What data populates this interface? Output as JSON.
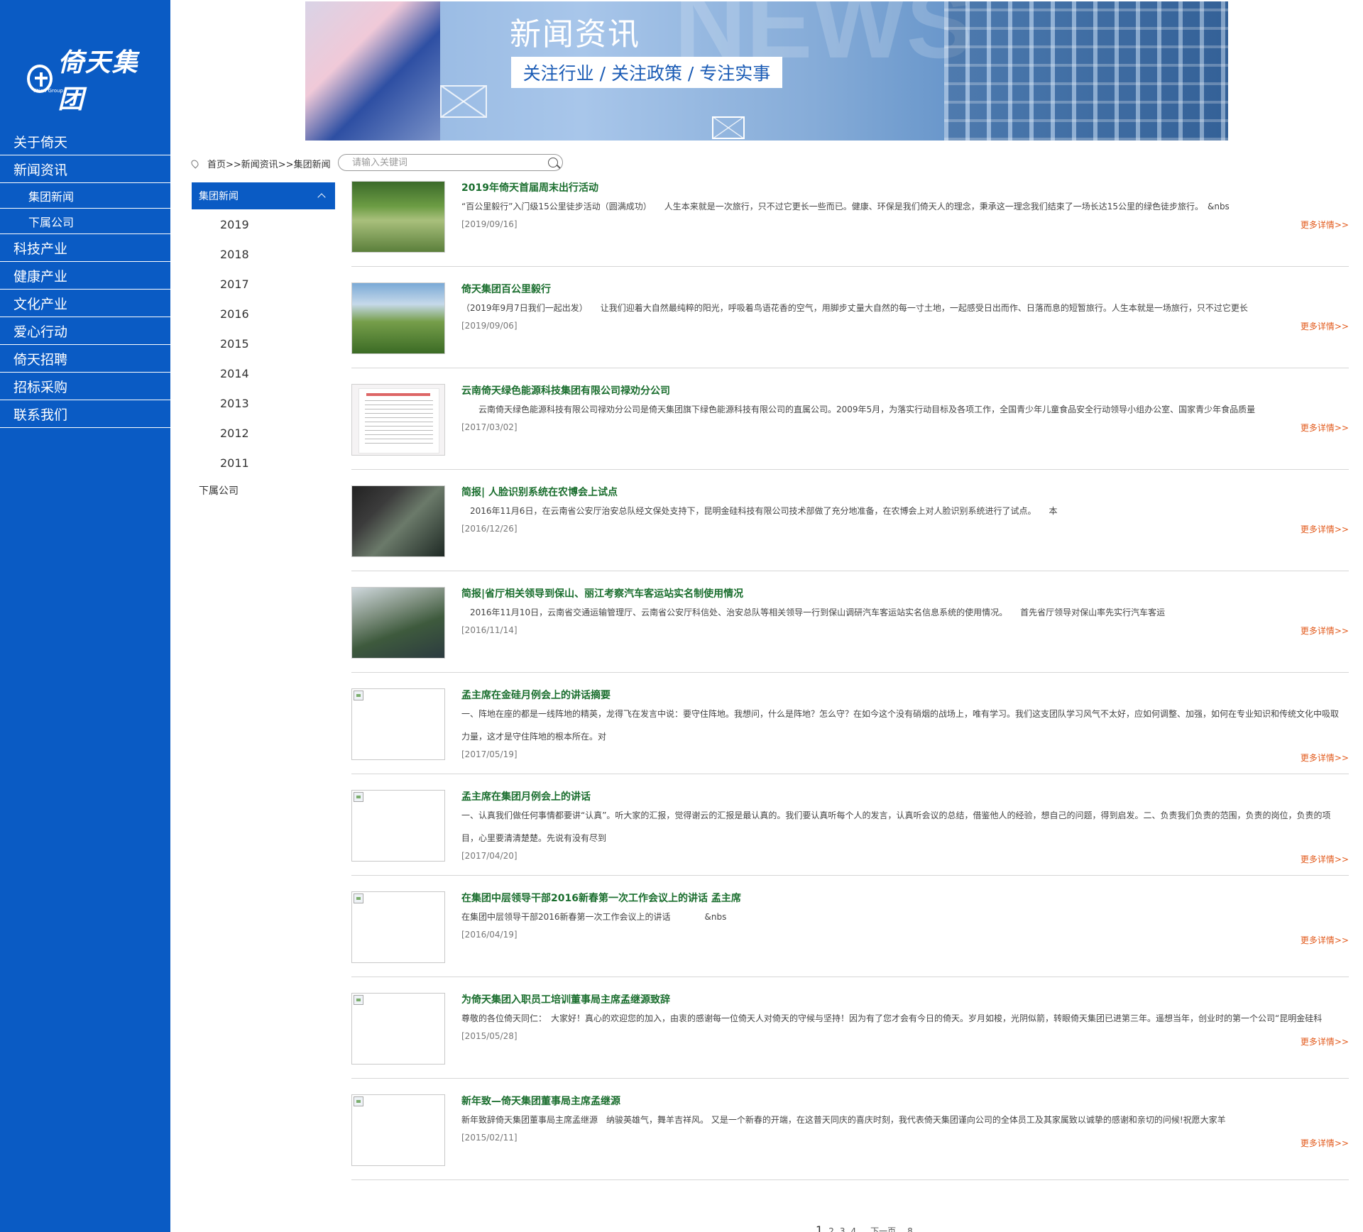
{
  "sidebar": {
    "logo_text": "倚天集团",
    "logo_sub": "Yitian Group",
    "nav": [
      {
        "label": "关于倚天",
        "sub": false
      },
      {
        "label": "新闻资讯",
        "sub": false
      },
      {
        "label": "集团新闻",
        "sub": true
      },
      {
        "label": "下属公司",
        "sub": true
      },
      {
        "label": "科技产业",
        "sub": false
      },
      {
        "label": "健康产业",
        "sub": false
      },
      {
        "label": "文化产业",
        "sub": false
      },
      {
        "label": "爱心行动",
        "sub": false
      },
      {
        "label": "倚天招聘",
        "sub": false
      },
      {
        "label": "招标采购",
        "sub": false
      },
      {
        "label": "联系我们",
        "sub": false
      }
    ]
  },
  "banner": {
    "ghost_text": "NEWS",
    "title": "新闻资讯",
    "tagline": "关注行业 / 关注政策 / 专注实事"
  },
  "breadcrumb": {
    "text": "首页>>新闻资讯>>集团新闻"
  },
  "search": {
    "placeholder": "请输入关键词"
  },
  "category": {
    "header": "集团新闻",
    "years": [
      "2019",
      "2018",
      "2017",
      "2016",
      "2015",
      "2014",
      "2013",
      "2012",
      "2011"
    ],
    "footer": "下属公司"
  },
  "more_label": "更多详情>>",
  "news": [
    {
      "title": "2019年倚天首届周末出行活动",
      "summary": "“百公里毅行”入门级15公里徒步活动（圆满成功）　　人生本来就是一次旅行，只不过它更长一些而已。健康、环保是我们倚天人的理念，秉承这一理念我们结束了一场长达15公里的绿色徒步旅行。　&nbs",
      "date": "[2019/09/16]"
    },
    {
      "title": "倚天集团百公里毅行",
      "summary": "（2019年9月7日我们一起出发）　　让我们迎着大自然最纯粹的阳光，呼吸着鸟语花香的空气，用脚步丈量大自然的每一寸土地，一起感受日出而作、日落而息的短暂旅行。人生本就是一场旅行，只不过它更长",
      "date": "[2019/09/06]"
    },
    {
      "title": "云南倚天绿色能源科技集团有限公司禄劝分公司",
      "summary": "　　云南倚天绿色能源科技有限公司禄劝分公司是倚天集团旗下绿色能源科技有限公司的直属公司。2009年5月，为落实行动目标及各项工作，全国青少年儿童食品安全行动领导小组办公室、国家青少年食品质量",
      "date": "[2017/03/02]"
    },
    {
      "title": "简报| 人脸识别系统在农博会上试点",
      "summary": "　2016年11月6日，在云南省公安厅治安总队经文保处支持下，昆明金硅科技有限公司技术部做了充分地准备，在农博会上对人脸识别系统进行了试点。　　本",
      "date": "[2016/12/26]"
    },
    {
      "title": "简报|省厅相关领导到保山、丽江考察汽车客运站实名制使用情况",
      "summary": "　2016年11月10日，云南省交通运输管理厅、云南省公安厅科信处、治安总队等相关领导一行到保山调研汽车客运站实名信息系统的使用情况。　　首先省厅领导对保山率先实行汽车客运",
      "date": "[2016/11/14]"
    },
    {
      "title": "孟主席在金硅月例会上的讲话摘要",
      "summary": "一、阵地在座的都是一线阵地的精英，龙得飞在发言中说：要守住阵地。我想问，什么是阵地？怎么守？在如今这个没有硝烟的战场上，唯有学习。我们这支团队学习风气不太好，应如何调整、加强，如何在专业知识和传统文化中吸取力量，这才是守住阵地的根本所在。对",
      "date": "[2017/05/19]"
    },
    {
      "title": "孟主席在集团月例会上的讲话",
      "summary": "一、认真我们做任何事情都要讲“认真”。听大家的汇报，觉得谢云的汇报是最认真的。我们要认真听每个人的发言，认真听会议的总结，借鉴他人的经验，想自己的问题，得到启发。二、负责我们负责的范围，负责的岗位，负责的项目，心里要清清楚楚。先说有没有尽到",
      "date": "[2017/04/20]"
    },
    {
      "title": "在集团中层领导干部2016新春第一次工作会议上的讲话 孟主席",
      "summary": "在集团中层领导干部2016新春第一次工作会议上的讲话　　　　&nbs",
      "date": "[2016/04/19]"
    },
    {
      "title": "为倚天集团入职员工培训董事局主席孟继源致辞",
      "summary": "尊敬的各位倚天同仁：　大家好！真心的欢迎您的加入，由衷的感谢每一位倚天人对倚天的守候与坚持！因为有了您才会有今日的倚天。岁月如梭，光阴似箭，转眼倚天集团已进第三年。遥想当年，创业时的第一个公司“昆明金硅科",
      "date": "[2015/05/28]"
    },
    {
      "title": "新年致—倚天集团董事局主席孟继源",
      "summary": "新年致辞倚天集团董事局主席孟继源　纳骏英雄气，舞羊吉祥风。 又是一个新春的开端，在这普天同庆的喜庆时刻，我代表倚天集团谨向公司的全体员工及其家属致以诚挚的感谢和亲切的问候!祝愿大家羊",
      "date": "[2015/02/11]"
    }
  ],
  "pager": {
    "pages": [
      "1",
      "2",
      "3",
      "4"
    ],
    "next": "下一页",
    "last": "8"
  }
}
